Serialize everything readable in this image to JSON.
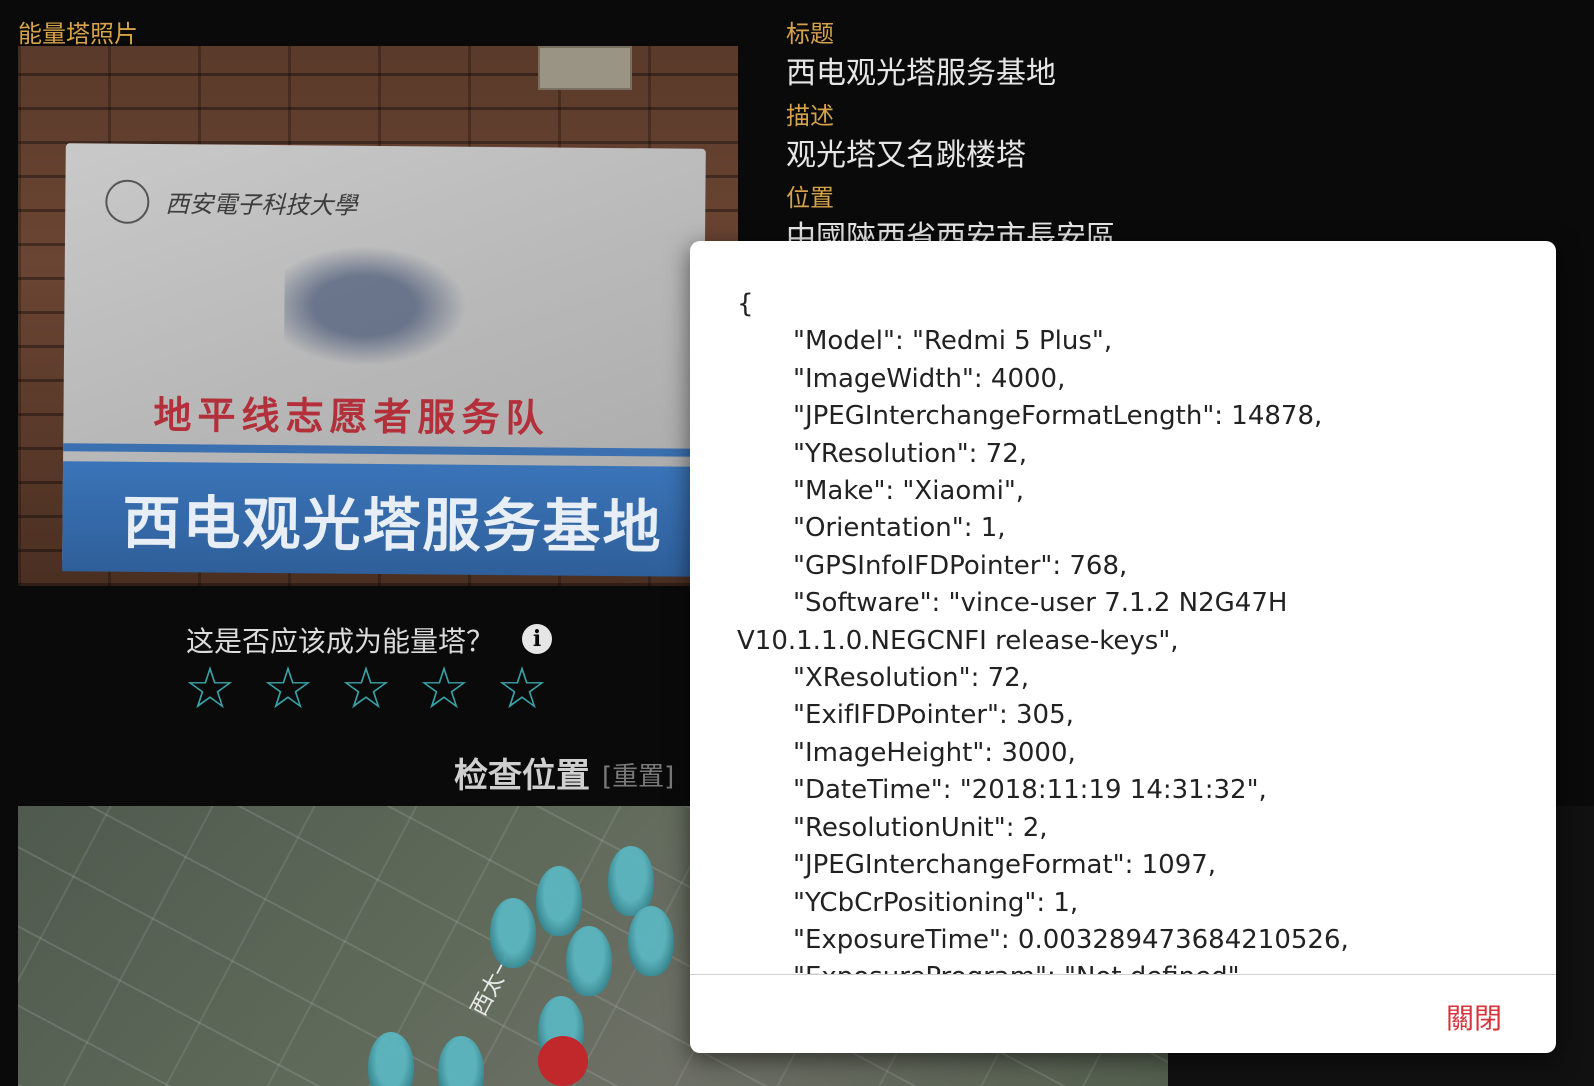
{
  "photo": {
    "label": "能量塔照片",
    "sign_school": "西安電子科技大學",
    "sign_red": "地平线志愿者服务队",
    "sign_blue": "西电观光塔服务基地"
  },
  "details": {
    "title_label": "标题",
    "title_value": "西电观光塔服务基地",
    "desc_label": "描述",
    "desc_value": "观光塔又名跳楼塔",
    "location_label": "位置",
    "location_value": "中國陝西省西安市長安區"
  },
  "rating": {
    "question": "这是否应该成为能量塔？",
    "info_icon": "i",
    "stars": [
      "☆",
      "☆",
      "☆",
      "☆",
      "☆"
    ],
    "accent_color": "#38a3a8"
  },
  "check": {
    "title": "检查位置",
    "reset": "[重置]"
  },
  "map": {
    "road_label": "西太一"
  },
  "modal": {
    "open_brace": "{",
    "lines": [
      "\"Model\": \"Redmi 5 Plus\",",
      "\"ImageWidth\": 4000,",
      "\"JPEGInterchangeFormatLength\": 14878,",
      "\"YResolution\": 72,",
      "\"Make\": \"Xiaomi\",",
      "\"Orientation\": 1,",
      "\"GPSInfoIFDPointer\": 768,",
      "\"Software\": \"vince-user 7.1.2 N2G47H V10.1.1.0.NEGCNFI release-keys\",",
      "\"XResolution\": 72,",
      "\"ExifIFDPointer\": 305,",
      "\"ImageHeight\": 3000,",
      "\"DateTime\": \"2018:11:19 14:31:32\",",
      "\"ResolutionUnit\": 2,",
      "\"JPEGInterchangeFormat\": 1097,",
      "\"YCbCrPositioning\": 1,",
      "\"ExposureTime\": 0.003289473684210526,",
      "\"ExposureProgram\": \"Not defined\","
    ],
    "close_label": "關閉",
    "close_color": "#d6333a"
  }
}
